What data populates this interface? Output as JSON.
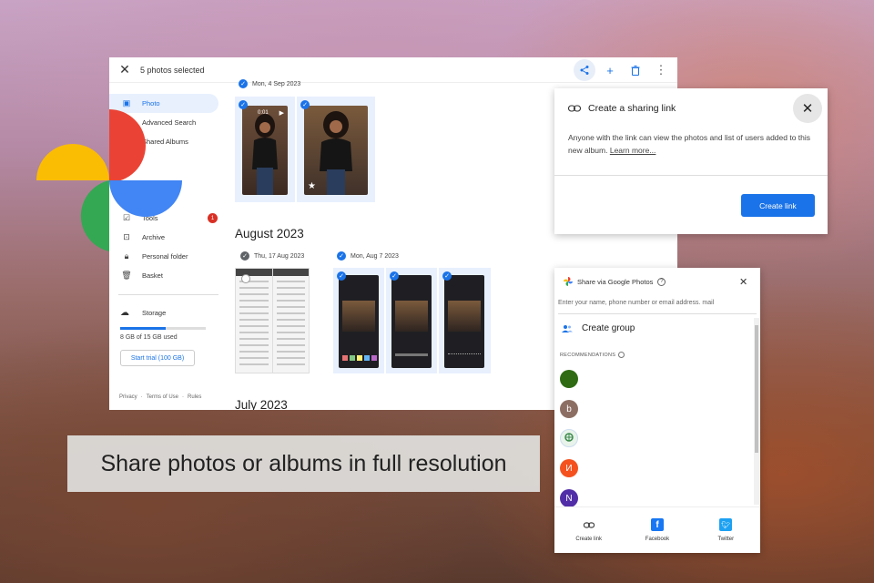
{
  "main": {
    "selected_count": "5 photos selected",
    "nav": [
      {
        "label": "Photo",
        "icon": "photo-icon"
      },
      {
        "label": "Advanced Search",
        "icon": "search-icon"
      },
      {
        "label": "Shared Albums",
        "icon": "shared-icon"
      },
      {
        "label": "Tools",
        "icon": "tools-icon",
        "badge": "1"
      },
      {
        "label": "Archive",
        "icon": "archive-icon"
      },
      {
        "label": "Personal folder",
        "icon": "lock-icon"
      },
      {
        "label": "Basket",
        "icon": "trash-icon"
      }
    ],
    "storage": {
      "label": "Storage",
      "used": "8 GB of 15 GB used",
      "fraction": 0.53,
      "trial_button": "Start trial (100 GB)"
    },
    "footer": [
      "Privacy",
      "·",
      "Terms of Use",
      "·",
      "Rules"
    ],
    "sections": {
      "first_date": "Mon, 4 Sep 2023",
      "video_duration": "0:01",
      "month_aug": "August 2023",
      "date_aug_17": "Thu, 17 Aug 2023",
      "date_aug_7": "Mon, Aug 7 2023",
      "month_jul": "July 2023"
    }
  },
  "share_link": {
    "title": "Create a sharing link",
    "description": "Anyone with the link can view the photos and list of users added to this new album.",
    "learn_more": "Learn more...",
    "button": "Create link"
  },
  "share_gp": {
    "title": "Share via Google Photos",
    "input_placeholder": "Enter your name, phone number or email address.",
    "input_suffix": "mail",
    "create_group": "Create  group",
    "recommendations": "RECOMMENDATIONS",
    "avatars": [
      {
        "letter": "",
        "color": "#2e6b12"
      },
      {
        "letter": "b",
        "color": "#8d6e63"
      },
      {
        "letter": "",
        "color": "#e8f3ea"
      },
      {
        "letter": "И",
        "color": "#f4511e"
      },
      {
        "letter": "N",
        "color": "#512da8"
      }
    ],
    "options": [
      {
        "label": "Create link",
        "icon": "link-icon"
      },
      {
        "label": "Facebook",
        "icon": "facebook-icon"
      },
      {
        "label": "Twitter",
        "icon": "twitter-icon"
      }
    ]
  },
  "caption": "Share photos or albums in full resolution",
  "colors": {
    "accent": "#1a73e8",
    "badge": "#d93025"
  }
}
